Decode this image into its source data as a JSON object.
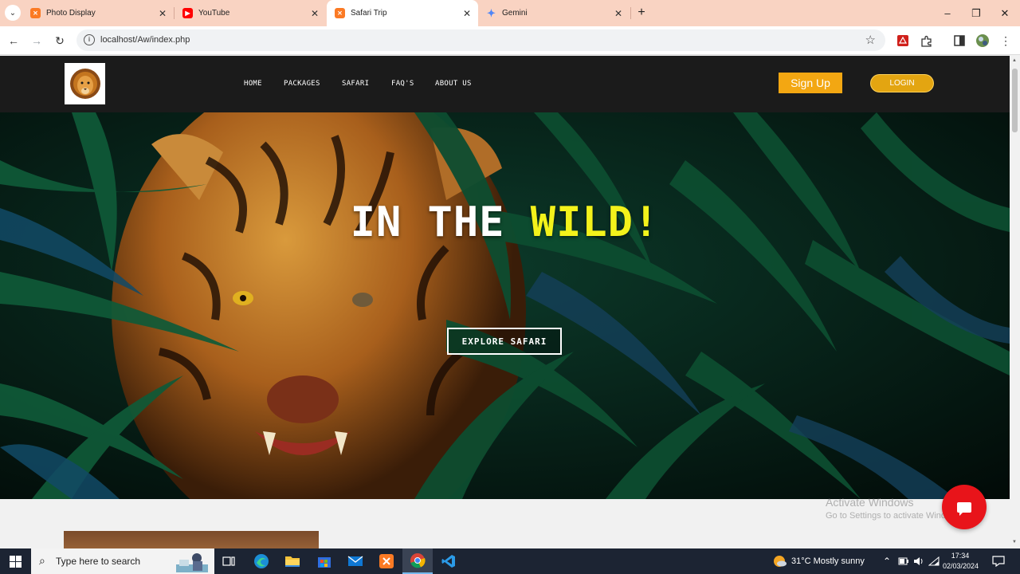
{
  "browser": {
    "tabs": [
      {
        "title": "Photo Display",
        "favicon": "xampp-icon",
        "color": "#fb7a24"
      },
      {
        "title": "YouTube",
        "favicon": "youtube-icon",
        "color": "#ff0000"
      },
      {
        "title": "Safari Trip",
        "favicon": "xampp-icon",
        "color": "#fb7a24",
        "active": true
      },
      {
        "title": "Gemini",
        "favicon": "gemini-sparkle-icon",
        "color": "#4f86f7"
      }
    ],
    "url": "localhost/Aw/index.php"
  },
  "site": {
    "nav": [
      "HOME",
      "PACKAGES",
      "SAFARI",
      "FAQ'S",
      "ABOUT US"
    ],
    "signup_label": "Sign Up",
    "login_label": "LOGIN",
    "hero": {
      "heading_white": "IN THE ",
      "heading_accent": "WILD!",
      "accent_color": "#f3f21b",
      "cta_label": "EXPLORE SAFARI"
    }
  },
  "watermark": {
    "line1": "Activate Windows",
    "line2": "Go to Settings to activate Windows."
  },
  "taskbar": {
    "search_placeholder": "Type here to search",
    "weather": "31°C  Mostly sunny",
    "time": "17:34",
    "date": "02/03/2024"
  }
}
